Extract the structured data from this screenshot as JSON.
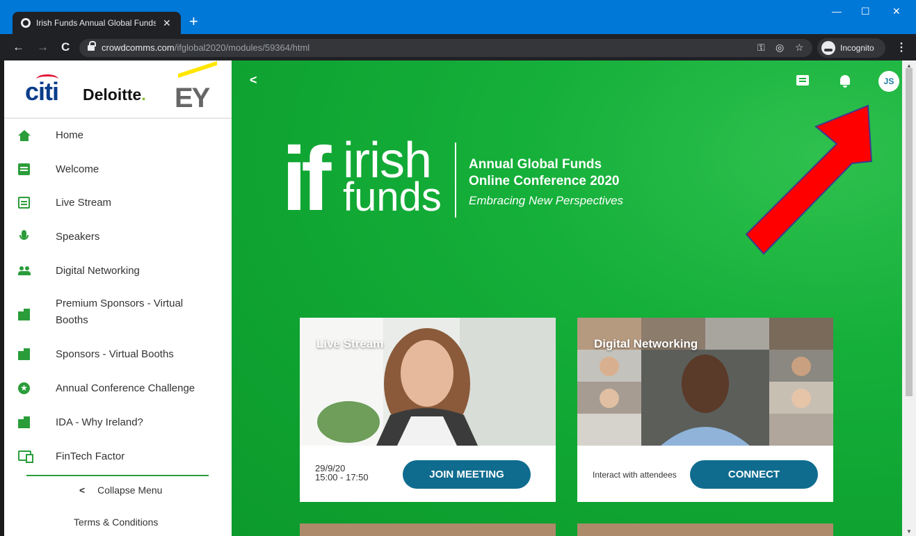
{
  "browser": {
    "tab_title": "Irish Funds Annual Global Funds",
    "tab_close": "✕",
    "new_tab": "+",
    "url_host": "crowdcomms.com",
    "url_path": "/ifglobal2020/modules/59364/html",
    "incognito_label": "Incognito",
    "back": "←",
    "forward": "→",
    "reload": "C",
    "minimize": "—",
    "maximize": "☐",
    "close": "✕",
    "menu": "⋮"
  },
  "sponsors": {
    "citi": "citi",
    "deloitte": "Deloitte",
    "deloitte_dot": ".",
    "ey": "EY"
  },
  "sidebar": {
    "items": [
      {
        "label": "Home",
        "icon": "home-icon"
      },
      {
        "label": "Welcome",
        "icon": "message-icon"
      },
      {
        "label": "Live Stream",
        "icon": "calendar-icon"
      },
      {
        "label": "Speakers",
        "icon": "microphone-icon"
      },
      {
        "label": "Digital Networking",
        "icon": "people-icon"
      },
      {
        "label": "Premium Sponsors - Virtual Booths",
        "icon": "building-icon"
      },
      {
        "label": "Sponsors - Virtual Booths",
        "icon": "building-icon"
      },
      {
        "label": "Annual Conference Challenge",
        "icon": "star-icon"
      },
      {
        "label": "IDA - Why Ireland?",
        "icon": "city-icon"
      },
      {
        "label": "FinTech Factor",
        "icon": "fintech-icon"
      }
    ],
    "collapse_label": "Collapse Menu",
    "collapse_chevron": "<",
    "terms_label": "Terms & Conditions"
  },
  "main": {
    "back_chevron": "<",
    "avatar_initials": "JS",
    "logo_if": "if",
    "logo_irish": "irish",
    "logo_funds": "funds",
    "conf_title_line1": "Annual Global Funds",
    "conf_title_line2": "Online Conference 2020",
    "conf_tagline": "Embracing New Perspectives",
    "cards": [
      {
        "title": "Live Stream",
        "date": "29/9/20",
        "time": "15:00 - 17:50",
        "button": "JOIN MEETING"
      },
      {
        "title": "Digital Networking",
        "subtitle": "Interact with attendees",
        "button": "CONNECT"
      }
    ]
  },
  "colors": {
    "brand_green": "#15b03a",
    "button_teal": "#0f6c8f",
    "arrow_red": "#ff0000",
    "chrome_blue": "#0078d7"
  }
}
